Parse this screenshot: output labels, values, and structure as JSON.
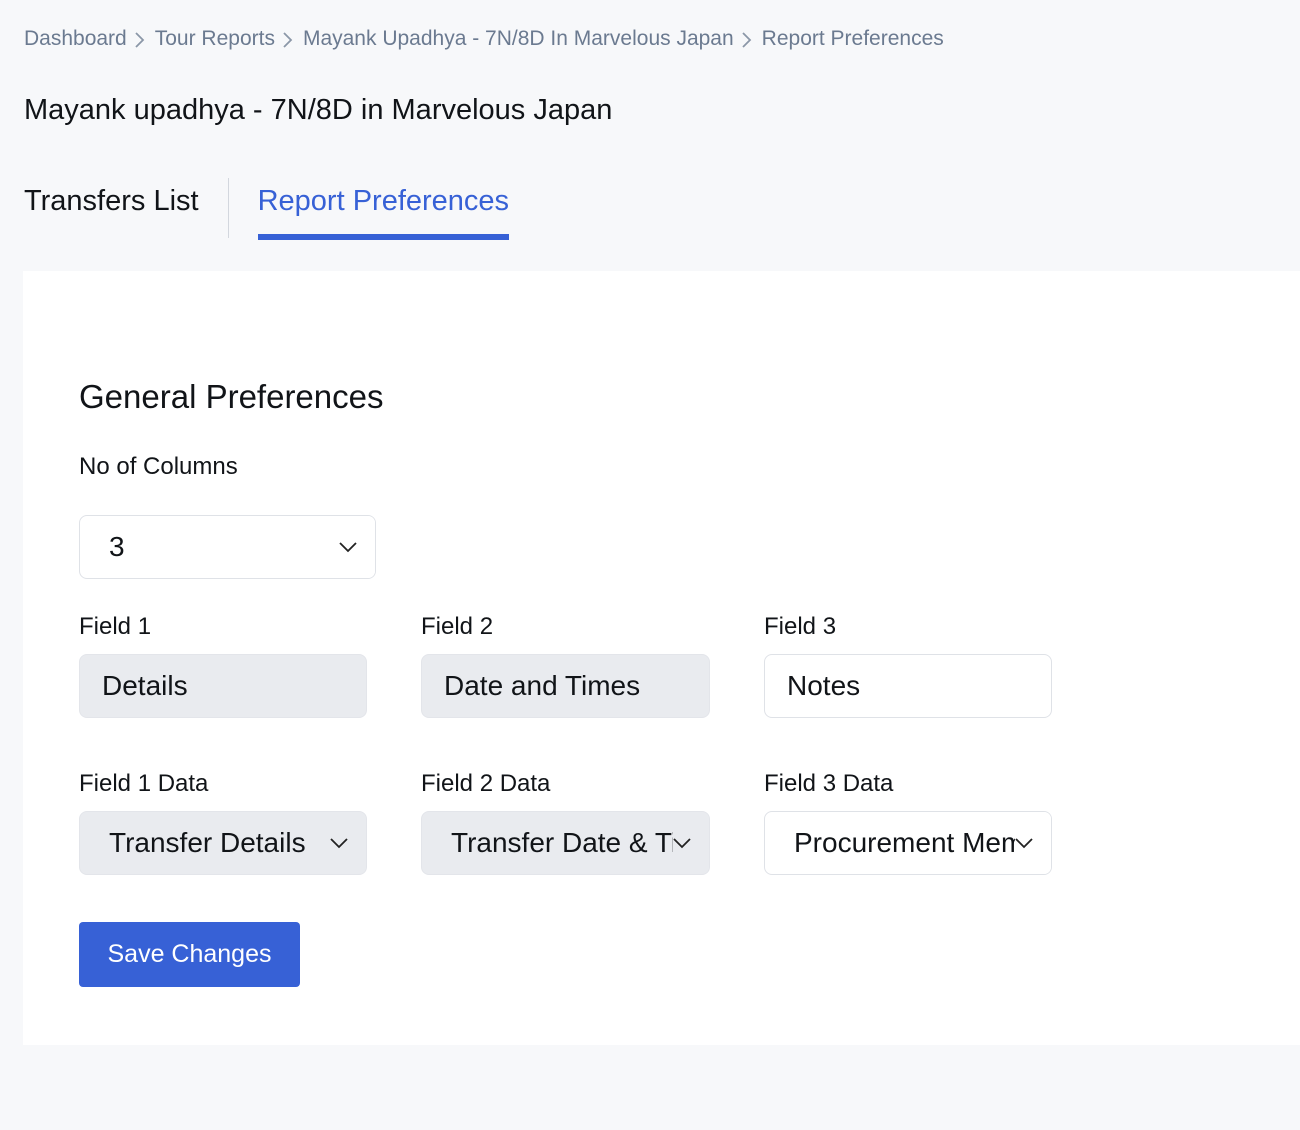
{
  "breadcrumb": {
    "items": [
      "Dashboard",
      "Tour Reports",
      "Mayank Upadhya - 7N/8D In Marvelous Japan",
      "Report Preferences"
    ]
  },
  "page_title": "Mayank upadhya - 7N/8D in Marvelous Japan",
  "tabs": [
    {
      "label": "Transfers List",
      "active": false
    },
    {
      "label": "Report Preferences",
      "active": true
    }
  ],
  "preferences": {
    "section_title": "General Preferences",
    "columns_label": "No of Columns",
    "columns_value": "3",
    "fields": [
      {
        "label": "Field 1",
        "value": "Details",
        "data_label": "Field 1 Data",
        "data_value": "Transfer Details"
      },
      {
        "label": "Field 2",
        "value": "Date and Times",
        "data_label": "Field 2 Data",
        "data_value": "Transfer Date & Time"
      },
      {
        "label": "Field 3",
        "value": "Notes",
        "data_label": "Field 3 Data",
        "data_value": "Procurement Memo"
      }
    ],
    "save_label": "Save Changes"
  },
  "colors": {
    "accent": "#3761d6",
    "background": "#f7f8fa",
    "panel": "#ffffff",
    "disabled_field": "#e9ebef",
    "breadcrumb_text": "#6b7a90"
  },
  "icons": {
    "breadcrumb_separator": "chevron-right-icon",
    "select_arrow": "chevron-down-icon"
  }
}
